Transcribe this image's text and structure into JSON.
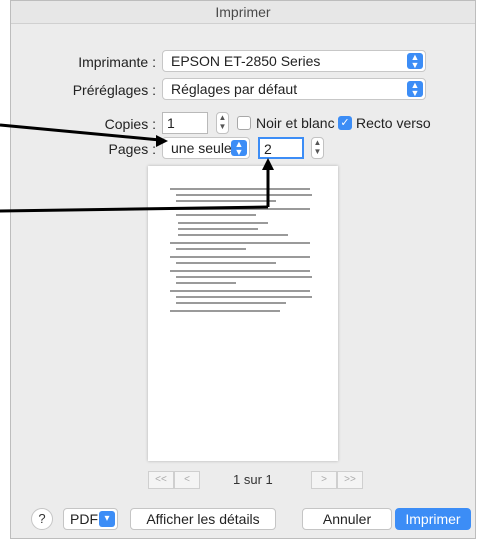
{
  "window": {
    "title": "Imprimer"
  },
  "printer": {
    "label": "Imprimante :",
    "value": "EPSON ET-2850 Series"
  },
  "presets": {
    "label": "Préréglages :",
    "value": "Réglages par défaut"
  },
  "copies": {
    "label": "Copies :",
    "value": "1",
    "bw_label": "Noir et blanc",
    "bw_checked": false,
    "duplex_label": "Recto verso",
    "duplex_checked": true
  },
  "pages": {
    "label": "Pages :",
    "mode": "une seule",
    "value": "2"
  },
  "preview": {
    "page_indicator": "1 sur 1",
    "nav": [
      "<<",
      "<",
      ">",
      ">>"
    ]
  },
  "footer": {
    "help": "?",
    "pdf": "PDF",
    "details": "Afficher les détails",
    "cancel": "Annuler",
    "print": "Imprimer"
  },
  "colors": {
    "accent": "#3c8df6",
    "annotation": "#000000"
  }
}
